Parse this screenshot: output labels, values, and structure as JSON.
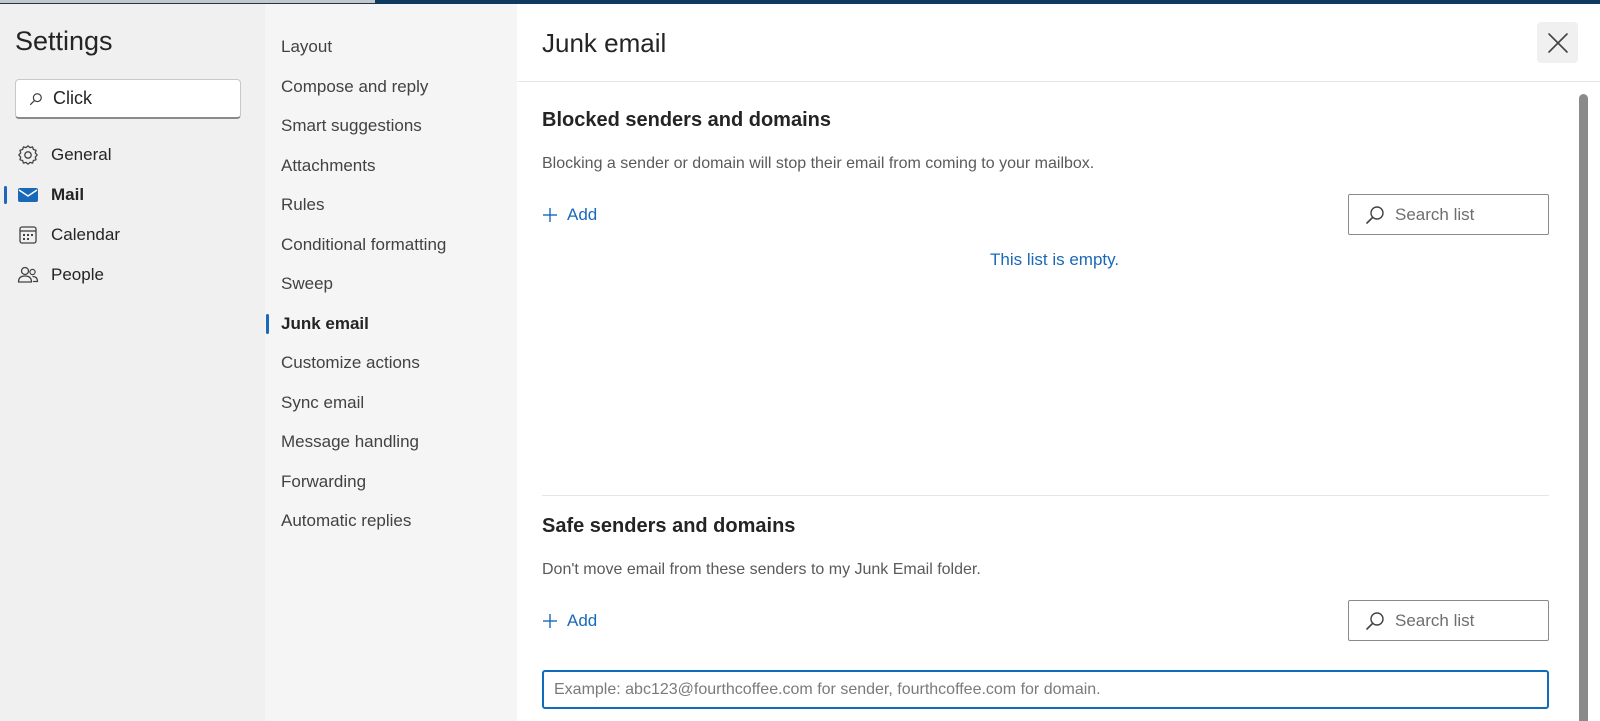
{
  "window": {
    "settings_title": "Settings",
    "search": {
      "value": "Click"
    }
  },
  "leftnav": {
    "items": [
      {
        "label": "General",
        "icon": "gear-icon"
      },
      {
        "label": "Mail",
        "icon": "mail-icon",
        "active": true
      },
      {
        "label": "Calendar",
        "icon": "calendar-icon"
      },
      {
        "label": "People",
        "icon": "people-icon"
      }
    ]
  },
  "midnav": {
    "items": [
      {
        "label": "Layout"
      },
      {
        "label": "Compose and reply"
      },
      {
        "label": "Smart suggestions"
      },
      {
        "label": "Attachments"
      },
      {
        "label": "Rules"
      },
      {
        "label": "Conditional formatting"
      },
      {
        "label": "Sweep"
      },
      {
        "label": "Junk email",
        "active": true
      },
      {
        "label": "Customize actions"
      },
      {
        "label": "Sync email"
      },
      {
        "label": "Message handling"
      },
      {
        "label": "Forwarding"
      },
      {
        "label": "Automatic replies"
      }
    ]
  },
  "content": {
    "title": "Junk email",
    "blocked": {
      "title": "Blocked senders and domains",
      "description": "Blocking a sender or domain will stop their email from coming to your mailbox.",
      "add_label": "Add",
      "search_placeholder": "Search list",
      "empty_message": "This list is empty."
    },
    "safe": {
      "title": "Safe senders and domains",
      "description": "Don't move email from these senders to my Junk Email folder.",
      "add_label": "Add",
      "search_placeholder": "Search list",
      "input_placeholder": "Example: abc123@fourthcoffee.com for sender, fourthcoffee.com for domain."
    }
  },
  "colors": {
    "accent": "#1a69b8",
    "focus_border": "#0f6cbd",
    "top_bar": "#0f3a5f"
  }
}
